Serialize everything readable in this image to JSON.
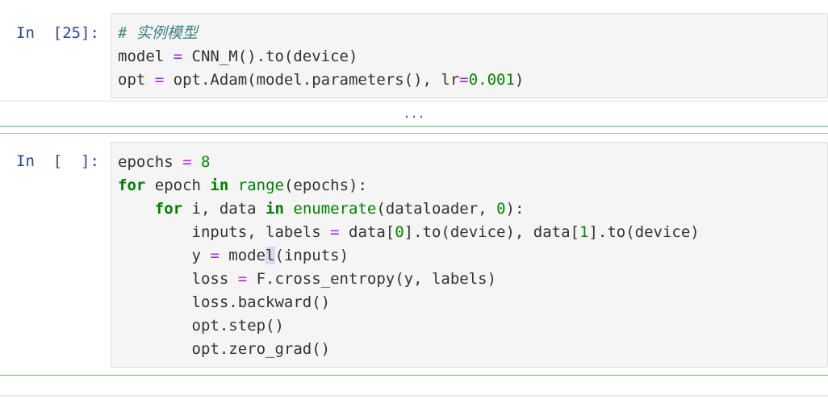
{
  "cells": [
    {
      "prompt": "In  [25]:",
      "lines": {
        "l0": "# 实例模型",
        "l1a": "model ",
        "l1b": "=",
        "l1c": " CNN_M().to(device)",
        "l2a": "opt ",
        "l2b": "=",
        "l2c": " opt.Adam(model.parameters(), lr",
        "l2d": "=",
        "l2e": "0.001",
        "l2f": ")"
      },
      "collapsed_marker": "..."
    },
    {
      "prompt": "In  [  ]:",
      "lines": {
        "a0": "epochs ",
        "a1": "=",
        "a2": " ",
        "a3": "8",
        "b0": "for",
        "b1": " epoch ",
        "b2": "in",
        "b3": " ",
        "b4": "range",
        "b5": "(epochs):",
        "c0": "    ",
        "c1": "for",
        "c2": " i, data ",
        "c3": "in",
        "c4": " ",
        "c5": "enumerate",
        "c6": "(dataloader, ",
        "c7": "0",
        "c8": "):",
        "d0": "        inputs, labels ",
        "d1": "=",
        "d2": " data[",
        "d3": "0",
        "d4": "].to(device), data[",
        "d5": "1",
        "d6": "].to(device)",
        "e0": "        y ",
        "e1": "=",
        "e2": " mode",
        "e3": "l",
        "e4": "(inputs)",
        "f0": "        loss ",
        "f1": "=",
        "f2": " F.cross_entropy(y, labels)",
        "g0": "        loss.backward()",
        "h0": "        opt.step()",
        "i0": "        opt.zero_grad()"
      }
    }
  ]
}
